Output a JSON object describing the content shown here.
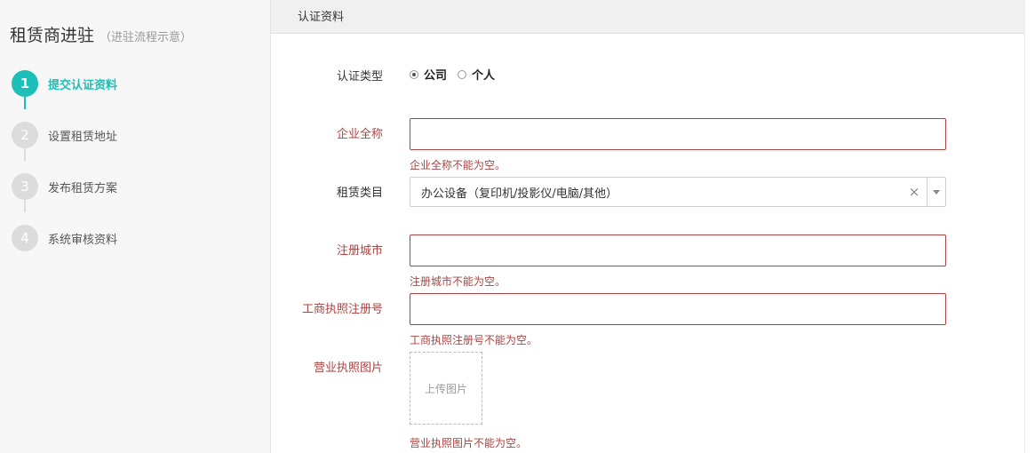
{
  "sidebar": {
    "title": "租赁商进驻",
    "subtitle": "（进驻流程示意）",
    "steps": [
      {
        "num": "1",
        "label": "提交认证资料"
      },
      {
        "num": "2",
        "label": "设置租赁地址"
      },
      {
        "num": "3",
        "label": "发布租赁方案"
      },
      {
        "num": "4",
        "label": "系统审核资料"
      }
    ]
  },
  "panel": {
    "title": "认证资料"
  },
  "form": {
    "type_label": "认证类型",
    "type_options": [
      "公司",
      "个人"
    ],
    "type_selected": "公司",
    "company_name_label": "企业全称",
    "company_name_value": "",
    "company_name_error": "企业全称不能为空。",
    "category_label": "租赁类目",
    "category_value": "办公设备（复印机/投影仪/电脑/其他）",
    "city_label": "注册城市",
    "city_value": "",
    "city_error": "注册城市不能为空。",
    "license_no_label": "工商执照注册号",
    "license_no_value": "",
    "license_no_error": "工商执照注册号不能为空。",
    "license_img_label": "营业执照图片",
    "upload_label": "上传图片",
    "license_img_error": "营业执照图片不能为空。"
  },
  "colors": {
    "accent": "#1dbfb8",
    "error": "#a94442",
    "step_inactive": "#dcdcdc"
  },
  "icons": {
    "clear": "×",
    "dropdown": "chevron-down-icon"
  }
}
